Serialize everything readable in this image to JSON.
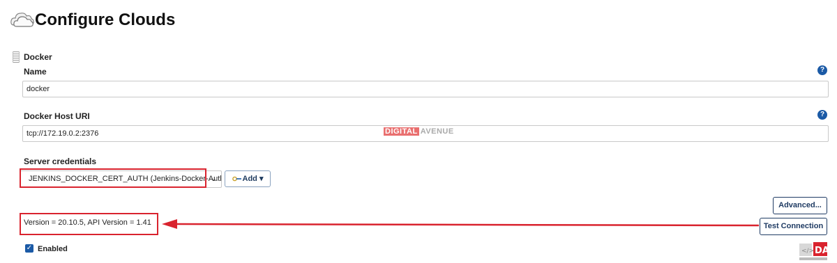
{
  "header": {
    "title": "Configure Clouds",
    "icon": "cloud-icon"
  },
  "section": {
    "title": "Docker"
  },
  "fields": {
    "name": {
      "label": "Name",
      "value": "docker",
      "help": "?"
    },
    "docker_host_uri": {
      "label": "Docker Host URI",
      "value": "tcp://172.19.0.2:2376",
      "help": "?"
    },
    "server_credentials": {
      "label": "Server credentials",
      "selected": "JENKINS_DOCKER_CERT_AUTH (Jenkins-Docker-Auth)",
      "add_label": "Add"
    }
  },
  "buttons": {
    "advanced": "Advanced...",
    "test_connection": "Test Connection"
  },
  "status": {
    "version_text": "Version = 20.10.5, API Version = 1.41"
  },
  "enabled": {
    "label": "Enabled",
    "checked": true
  },
  "watermark": {
    "part1": "DIGITAL",
    "part2": "AVENUE"
  },
  "colors": {
    "highlight": "#d9232e",
    "button_border": "#1f3b63",
    "help_icon": "#1b5aa6"
  }
}
